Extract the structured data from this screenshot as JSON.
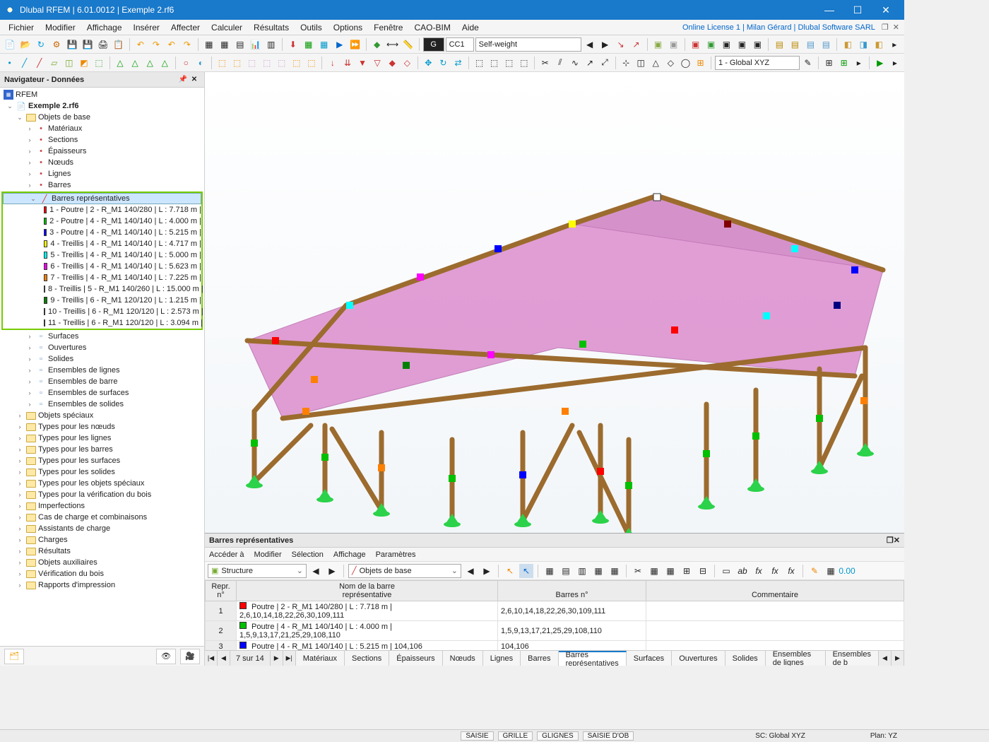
{
  "titlebar": {
    "text": "Dlubal RFEM | 6.01.0012 | Exemple 2.rf6"
  },
  "license_info": "Online License 1 | Milan Gérard | Dlubal Software SARL",
  "menubar": [
    "Fichier",
    "Modifier",
    "Affichage",
    "Insérer",
    "Affecter",
    "Calculer",
    "Résultats",
    "Outils",
    "Options",
    "Fenêtre",
    "CAO-BIM",
    "Aide"
  ],
  "toolbar2": {
    "loadcase_tag": "CC1",
    "loadcase_name": "Self-weight",
    "coord_system": "1 - Global XYZ"
  },
  "navigator": {
    "title": "Navigateur - Données",
    "root": "RFEM",
    "file": "Exemple 2.rf6",
    "objets_base": "Objets de base",
    "children_base": [
      "Matériaux",
      "Sections",
      "Épaisseurs",
      "Nœuds",
      "Lignes",
      "Barres"
    ],
    "rep_label": "Barres représentatives",
    "rep_items": [
      {
        "color": "#ff0000",
        "text": "1 - Poutre | 2 - R_M1 140/280 | L : 7.718 m |"
      },
      {
        "color": "#00c000",
        "text": "2 - Poutre | 4 - R_M1 140/140 | L : 4.000 m |"
      },
      {
        "color": "#0000ff",
        "text": "3 - Poutre | 4 - R_M1 140/140 | L : 5.215 m |"
      },
      {
        "color": "#ffff00",
        "text": "4 - Treillis | 4 - R_M1 140/140 | L : 4.717 m |"
      },
      {
        "color": "#00ffff",
        "text": "5 - Treillis | 4 - R_M1 140/140 | L : 5.000 m |"
      },
      {
        "color": "#ff00ff",
        "text": "6 - Treillis | 4 - R_M1 140/140 | L : 5.623 m |"
      },
      {
        "color": "#ff8000",
        "text": "7 - Treillis | 4 - R_M1 140/140 | L : 7.225 m |"
      },
      {
        "color": "#800000",
        "text": "8 - Treillis | 5 - R_M1 140/260 | L : 15.000 m |"
      },
      {
        "color": "#008000",
        "text": "9 - Treillis | 6 - R_M1 120/120 | L : 1.215 m |"
      },
      {
        "color": "#000080",
        "text": "10 - Treillis | 6 - R_M1 120/120 | L : 2.573 m |"
      },
      {
        "color": "#808000",
        "text": "11 - Treillis | 6 - R_M1 120/120 | L : 3.094 m |"
      }
    ],
    "after_rep": [
      "Surfaces",
      "Ouvertures",
      "Solides",
      "Ensembles de lignes",
      "Ensembles de barre",
      "Ensembles de surfaces",
      "Ensembles de solides"
    ],
    "folders": [
      "Objets spéciaux",
      "Types pour les nœuds",
      "Types pour les lignes",
      "Types pour les barres",
      "Types pour les surfaces",
      "Types pour les solides",
      "Types pour les objets spéciaux",
      "Types pour la vérification du bois",
      "Imperfections",
      "Cas de charge et combinaisons",
      "Assistants de charge",
      "Charges",
      "Résultats",
      "Objets auxiliaires",
      "Vérification du bois",
      "Rapports d'impression"
    ]
  },
  "bottom": {
    "title": "Barres représentatives",
    "menu": [
      "Accéder à",
      "Modifier",
      "Sélection",
      "Affichage",
      "Paramètres"
    ],
    "combo1": "Structure",
    "combo2": "Objets de base",
    "headers": {
      "col1a": "Repr.",
      "col1b": "n°",
      "col2a": "Nom de la barre",
      "col2b": "représentative",
      "col3": "Barres n°",
      "col4": "Commentaire"
    },
    "rows": [
      {
        "n": "1",
        "color": "#ff0000",
        "name": "Poutre | 2 - R_M1 140/280 | L : 7.718 m | 2,6,10,14,18,22,26,30,109,111",
        "bars": "2,6,10,14,18,22,26,30,109,111"
      },
      {
        "n": "2",
        "color": "#00c000",
        "name": "Poutre | 4 - R_M1 140/140 | L : 4.000 m | 1,5,9,13,17,21,25,29,108,110",
        "bars": "1,5,9,13,17,21,25,29,108,110"
      },
      {
        "n": "3",
        "color": "#0000ff",
        "name": "Poutre | 4 - R_M1 140/140 | L : 5.215 m | 104,106",
        "bars": "104,106"
      }
    ],
    "page": "7 sur 14",
    "tabs": [
      "Matériaux",
      "Sections",
      "Épaisseurs",
      "Nœuds",
      "Lignes",
      "Barres",
      "Barres représentatives",
      "Surfaces",
      "Ouvertures",
      "Solides",
      "Ensembles de lignes",
      "Ensembles de b"
    ],
    "active_tab": 6
  },
  "status": {
    "b1": "SAISIE",
    "b2": "GRILLE",
    "b3": "GLIGNES",
    "b4": "SAISIE D'OB",
    "sc": "SC: Global XYZ",
    "plan": "Plan: YZ"
  }
}
